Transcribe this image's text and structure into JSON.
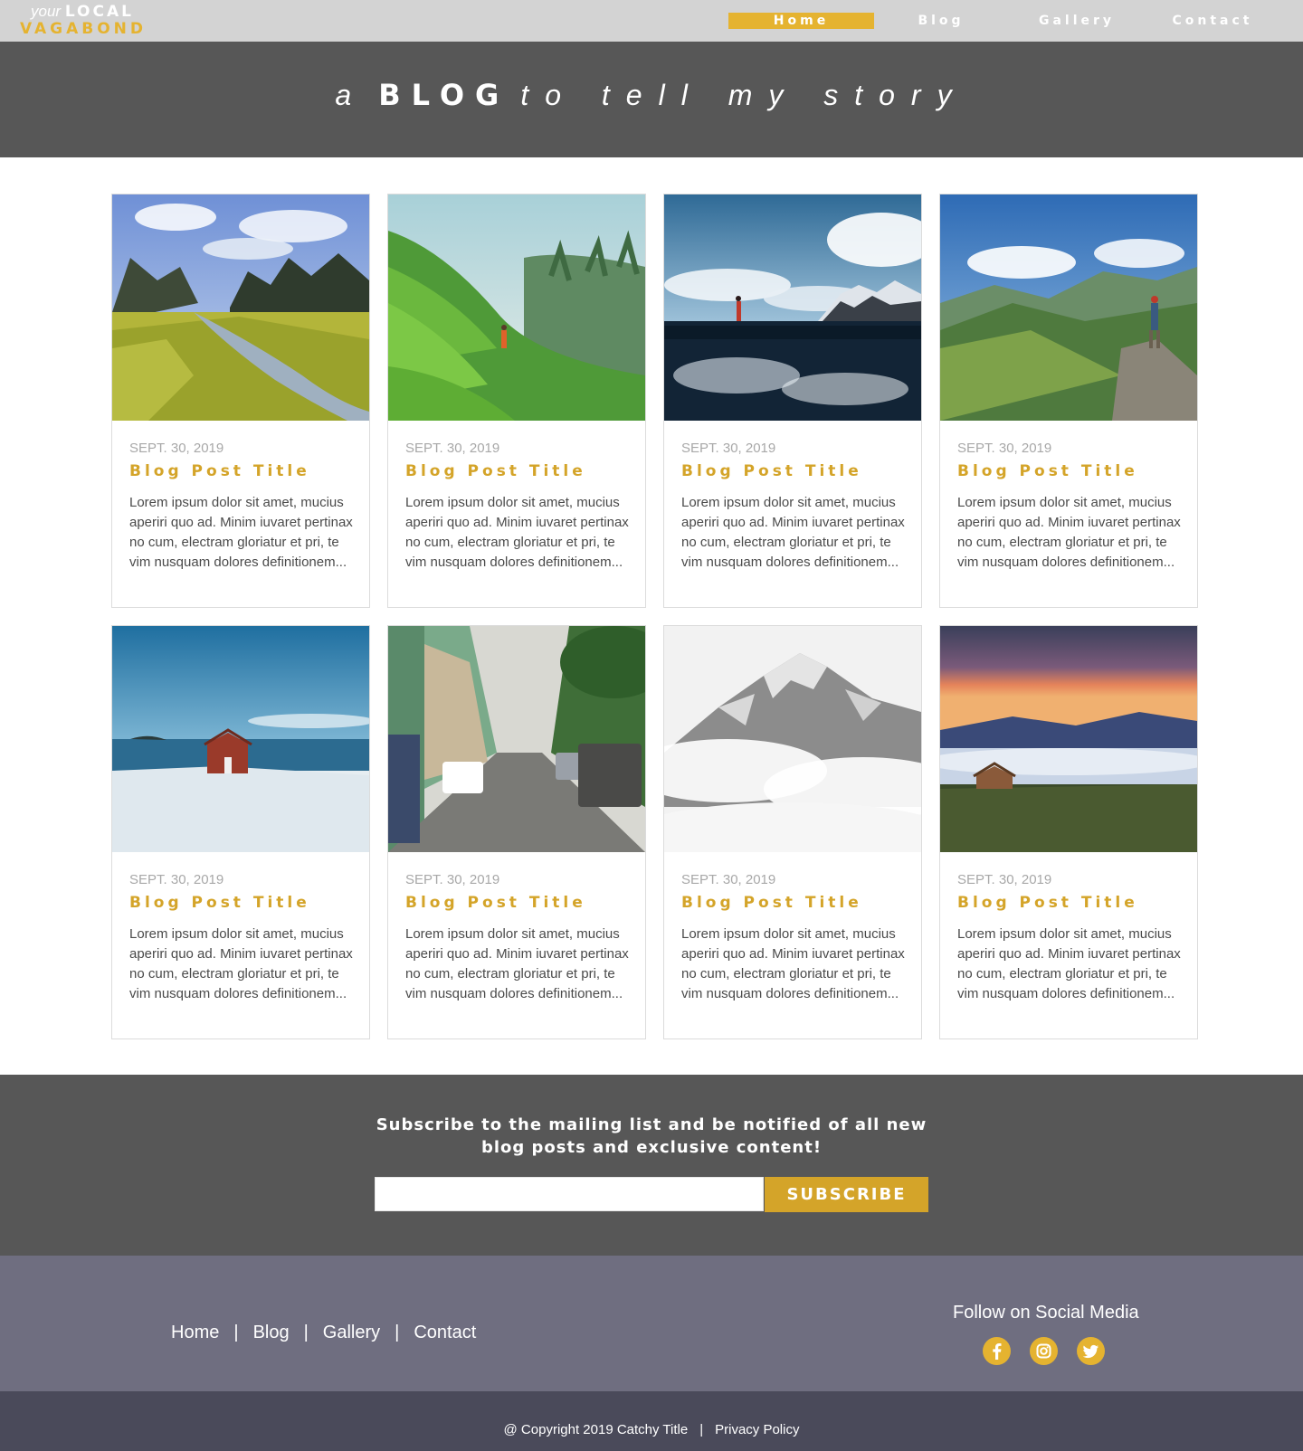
{
  "logo": {
    "your": "your",
    "local": "LOCAL",
    "vagabond": "VAGABOND"
  },
  "nav": {
    "items": [
      {
        "label": "Home",
        "active": true
      },
      {
        "label": "Blog",
        "active": false
      },
      {
        "label": "Gallery",
        "active": false
      },
      {
        "label": "Contact",
        "active": false
      }
    ]
  },
  "hero": {
    "pre": "a",
    "strong": "BLOG",
    "post": "to tell my story"
  },
  "posts": [
    {
      "date": "SEPT. 30, 2019",
      "title": "Blog Post Title",
      "excerpt": "Lorem ipsum dolor sit amet, mucius aperiri quo ad. Minim iuvaret pertinax no cum, electram gloriatur et pri, te vim nusquam dolores definitionem...",
      "image": "river-valley-karst-photo"
    },
    {
      "date": "SEPT. 30, 2019",
      "title": "Blog Post Title",
      "excerpt": "Lorem ipsum dolor sit amet, mucius aperiri quo ad. Minim iuvaret pertinax no cum, electram gloriatur et pri, te vim nusquam dolores definitionem...",
      "image": "rice-terrace-photo"
    },
    {
      "date": "SEPT. 30, 2019",
      "title": "Blog Post Title",
      "excerpt": "Lorem ipsum dolor sit amet, mucius aperiri quo ad. Minim iuvaret pertinax no cum, electram gloriatur et pri, te vim nusquam dolores definitionem...",
      "image": "lake-reflection-photo"
    },
    {
      "date": "SEPT. 30, 2019",
      "title": "Blog Post Title",
      "excerpt": "Lorem ipsum dolor sit amet, mucius aperiri quo ad. Minim iuvaret pertinax no cum, electram gloriatur et pri, te vim nusquam dolores definitionem...",
      "image": "mountain-hiker-photo"
    },
    {
      "date": "SEPT. 30, 2019",
      "title": "Blog Post Title",
      "excerpt": "Lorem ipsum dolor sit amet, mucius aperiri quo ad. Minim iuvaret pertinax no cum, electram gloriatur et pri, te vim nusquam dolores definitionem...",
      "image": "snowy-cabin-photo"
    },
    {
      "date": "SEPT. 30, 2019",
      "title": "Blog Post Title",
      "excerpt": "Lorem ipsum dolor sit amet, mucius aperiri quo ad. Minim iuvaret pertinax no cum, electram gloriatur et pri, te vim nusquam dolores definitionem...",
      "image": "city-street-photo"
    },
    {
      "date": "SEPT. 30, 2019",
      "title": "Blog Post Title",
      "excerpt": "Lorem ipsum dolor sit amet, mucius aperiri quo ad. Minim iuvaret pertinax no cum, electram gloriatur et pri, te vim nusquam dolores definitionem...",
      "image": "misty-mountain-photo"
    },
    {
      "date": "SEPT. 30, 2019",
      "title": "Blog Post Title",
      "excerpt": "Lorem ipsum dolor sit amet, mucius aperiri quo ad. Minim iuvaret pertinax no cum, electram gloriatur et pri, te vim nusquam dolores definitionem...",
      "image": "sunset-clouds-photo"
    }
  ],
  "subscribe": {
    "text": "Subscribe to the mailing list and be notified of all new blog posts and exclusive content!",
    "placeholder": "",
    "button": "SUBSCRIBE"
  },
  "footer": {
    "links": [
      "Home",
      "Blog",
      "Gallery",
      "Contact"
    ],
    "separator": "|",
    "social_title": "Follow on Social Media",
    "social": [
      "facebook-icon",
      "instagram-icon",
      "twitter-icon"
    ]
  },
  "bottom": {
    "copyright": "@ Copyright 2019 Catchy Title",
    "separator": "|",
    "privacy": "Privacy Policy"
  },
  "colors": {
    "accent": "#e5b330",
    "title_gold": "#d4a429",
    "dark_band": "#575757",
    "footer_bg": "#6f6e80",
    "bottom_bg": "#4a4a5a",
    "nav_bg": "#d3d3d3"
  }
}
